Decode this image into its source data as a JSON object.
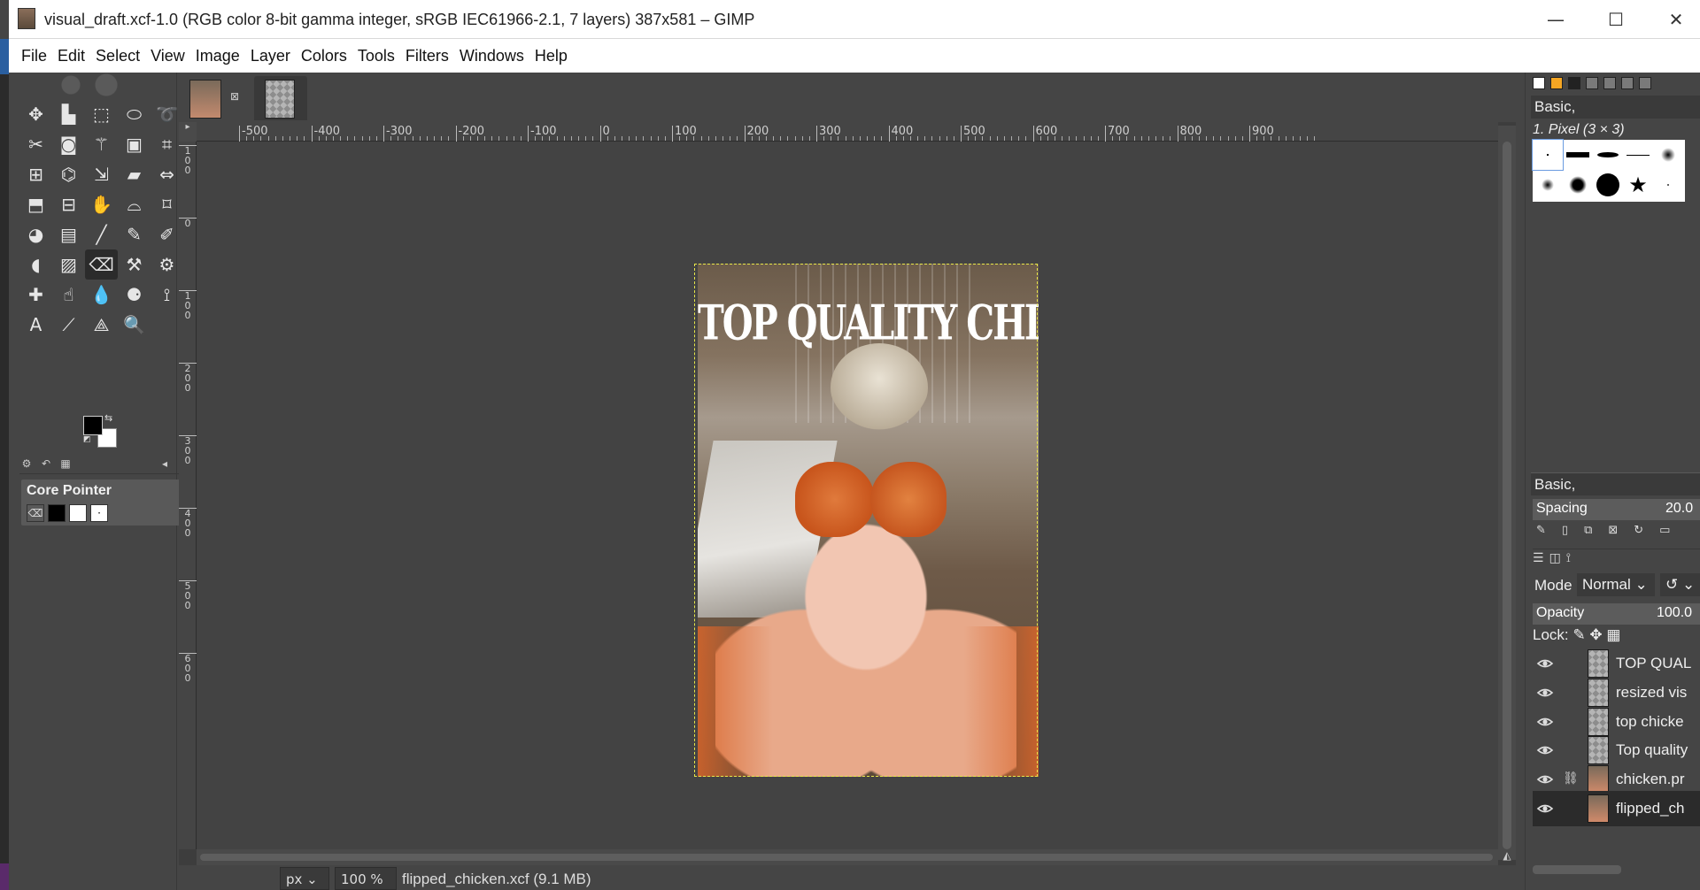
{
  "window": {
    "title": "visual_draft.xcf-1.0 (RGB color 8-bit gamma integer, sRGB IEC61966-2.1, 7 layers) 387x581 – GIMP",
    "min": "—",
    "max": "☐",
    "close": "✕"
  },
  "menu": [
    "File",
    "Edit",
    "Select",
    "View",
    "Image",
    "Layer",
    "Colors",
    "Tools",
    "Filters",
    "Windows",
    "Help"
  ],
  "tools": [
    {
      "icon": "move-icon",
      "glyph": "✥"
    },
    {
      "icon": "align-icon",
      "glyph": "▙"
    },
    {
      "icon": "rect-select-icon",
      "glyph": "⬚"
    },
    {
      "icon": "ellipse-select-icon",
      "glyph": "⬭"
    },
    {
      "icon": "free-select-icon",
      "glyph": "➰"
    },
    {
      "icon": "scissors-icon",
      "glyph": "✂"
    },
    {
      "icon": "foreground-select-icon",
      "glyph": "◙"
    },
    {
      "icon": "fuzzy-select-icon",
      "glyph": "⚚"
    },
    {
      "icon": "color-select-icon",
      "glyph": "▣"
    },
    {
      "icon": "crop-icon",
      "glyph": "⌗"
    },
    {
      "icon": "unified-transform-icon",
      "glyph": "⊞"
    },
    {
      "icon": "warp-transform-icon",
      "glyph": "⌬"
    },
    {
      "icon": "scale-icon",
      "glyph": "⇲"
    },
    {
      "icon": "shear-icon",
      "glyph": "▰"
    },
    {
      "icon": "flip-icon",
      "glyph": "⇔"
    },
    {
      "icon": "perspective-icon",
      "glyph": "⬒"
    },
    {
      "icon": "3d-transform-icon",
      "glyph": "⊟"
    },
    {
      "icon": "handle-transform-icon",
      "glyph": "✋"
    },
    {
      "icon": "cage-icon",
      "glyph": "⌓"
    },
    {
      "icon": "warp-icon",
      "glyph": "⌑"
    },
    {
      "icon": "bucket-fill-icon",
      "glyph": "◕"
    },
    {
      "icon": "gradient-icon",
      "glyph": "▤"
    },
    {
      "icon": "paintbrush-icon",
      "glyph": "╱"
    },
    {
      "icon": "pencil-icon",
      "glyph": "✎"
    },
    {
      "icon": "airbrush-icon",
      "glyph": "✐"
    },
    {
      "icon": "ink-icon",
      "glyph": "◖"
    },
    {
      "icon": "mypaint-brush-icon",
      "glyph": "▨"
    },
    {
      "icon": "eraser-icon",
      "glyph": "⌫"
    },
    {
      "icon": "clone-icon",
      "glyph": "⚒"
    },
    {
      "icon": "perspective-clone-icon",
      "glyph": "⚙"
    },
    {
      "icon": "heal-icon",
      "glyph": "✚"
    },
    {
      "icon": "smudge-icon",
      "glyph": "☝"
    },
    {
      "icon": "blur-icon",
      "glyph": "💧"
    },
    {
      "icon": "dodge-burn-icon",
      "glyph": "⚈"
    },
    {
      "icon": "paths-icon",
      "glyph": "⟟"
    },
    {
      "icon": "text-icon",
      "glyph": "A"
    },
    {
      "icon": "color-picker-icon",
      "glyph": "⟋"
    },
    {
      "icon": "measure-icon",
      "glyph": "⟁"
    },
    {
      "icon": "zoom-icon",
      "glyph": "🔍"
    }
  ],
  "tool_options": {
    "tabs": [
      "tool-options-tab",
      "undo-history-tab",
      "images-tab"
    ],
    "device_name": "Core Pointer"
  },
  "image_tabs": [
    {
      "name": "visual_draft",
      "close": "⊠"
    },
    {
      "name": "flipped_chicken"
    }
  ],
  "ruler": {
    "h_labels": [
      "-500",
      "-400",
      "-300",
      "-200",
      "-100",
      "0",
      "100",
      "200",
      "300",
      "400",
      "500",
      "600",
      "700",
      "800",
      "900"
    ],
    "v_labels": [
      "100",
      "0",
      "100",
      "200",
      "300",
      "400",
      "500",
      "600"
    ]
  },
  "canvas": {
    "headline": "TOP QUALITY CHICKEN"
  },
  "status": {
    "unit": "px",
    "zoom": "100 %",
    "file": "flipped_chicken.xcf (9.1 MB)"
  },
  "brushes": {
    "set": "Basic,",
    "selected": "1. Pixel (3 × 3)",
    "bottom_set": "Basic,",
    "spacing_label": "Spacing",
    "spacing_value": "20.0"
  },
  "layers_panel": {
    "mode_label": "Mode",
    "mode": "Normal",
    "opacity_label": "Opacity",
    "opacity_value": "100.0",
    "lock_label": "Lock:",
    "layers": [
      {
        "name": "TOP QUAL",
        "thumb": "transparent",
        "chain": false,
        "selected": false
      },
      {
        "name": "resized vis",
        "thumb": "transparent",
        "chain": false,
        "selected": false
      },
      {
        "name": "top chicke",
        "thumb": "transparent",
        "chain": false,
        "selected": false
      },
      {
        "name": "Top quality",
        "thumb": "transparent",
        "chain": false,
        "selected": false
      },
      {
        "name": "chicken.pr",
        "thumb": "photo",
        "chain": true,
        "selected": false
      },
      {
        "name": "flipped_ch",
        "thumb": "photo",
        "chain": false,
        "selected": true
      }
    ]
  }
}
